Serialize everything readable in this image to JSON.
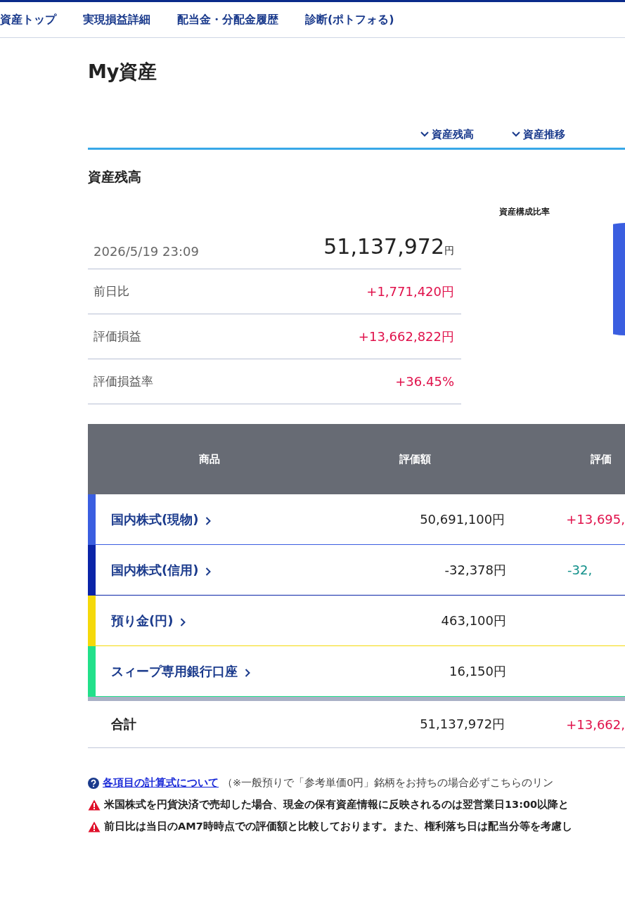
{
  "nav": [
    {
      "label": "資産トップ"
    },
    {
      "label": "実現損益詳細"
    },
    {
      "label": "配当金・分配金履歴"
    },
    {
      "label": "診断(ポトフォる)"
    }
  ],
  "title": "My資産",
  "anchors": [
    {
      "label": "資産残高"
    },
    {
      "label": "資産推移"
    }
  ],
  "section_title": "資産残高",
  "summary": {
    "timestamp": "2026/5/19 23:09",
    "total": "51,137,972",
    "unit": "円",
    "rows": [
      {
        "label": "前日比",
        "value": "+1,771,420円",
        "color": "#e0104a"
      },
      {
        "label": "評価損益",
        "value": "+13,662,822円",
        "color": "#e0104a"
      },
      {
        "label": "評価損益率",
        "value": "+36.45%",
        "color": "#e0104a"
      }
    ]
  },
  "composition": {
    "title": "資産構成比率"
  },
  "table": {
    "columns": [
      "商品",
      "評価額",
      "評価"
    ],
    "rows": [
      {
        "name": "国内株式(現物)",
        "color": "#3a5ee0",
        "amount": "50,691,100円",
        "pl": {
          "text": "+13,695,",
          "color": "#e0104a"
        }
      },
      {
        "name": "国内株式(信用)",
        "color": "#0a24a8",
        "amount": "-32,378円",
        "pl": {
          "text": "-32,",
          "color": "#12908a"
        }
      },
      {
        "name": "預り金(円)",
        "color": "#f5d90a",
        "amount": "463,100円"
      },
      {
        "name": "スィープ専用銀行口座",
        "color": "#22e08a",
        "amount": "16,150円"
      }
    ],
    "total": {
      "label": "合計",
      "amount": "51,137,972円",
      "pl": {
        "text": "+13,662,",
        "color": "#e0104a"
      }
    }
  },
  "notes": [
    {
      "kind": "help",
      "link": "各項目の計算式について",
      "text": "（※一般預りで「参考単価0円」銘柄をお持ちの場合必ずこちらのリン"
    },
    {
      "kind": "warning",
      "text": "米国株式を円貨決済で売却した場合、現金の保有資産情報に反映されるのは翌営業日13:00以降と"
    },
    {
      "kind": "warning",
      "text": "前日比は当日のAM7時時点での評価額と比較しております。また、権利落ち日は配当分等を考慮し"
    }
  ]
}
